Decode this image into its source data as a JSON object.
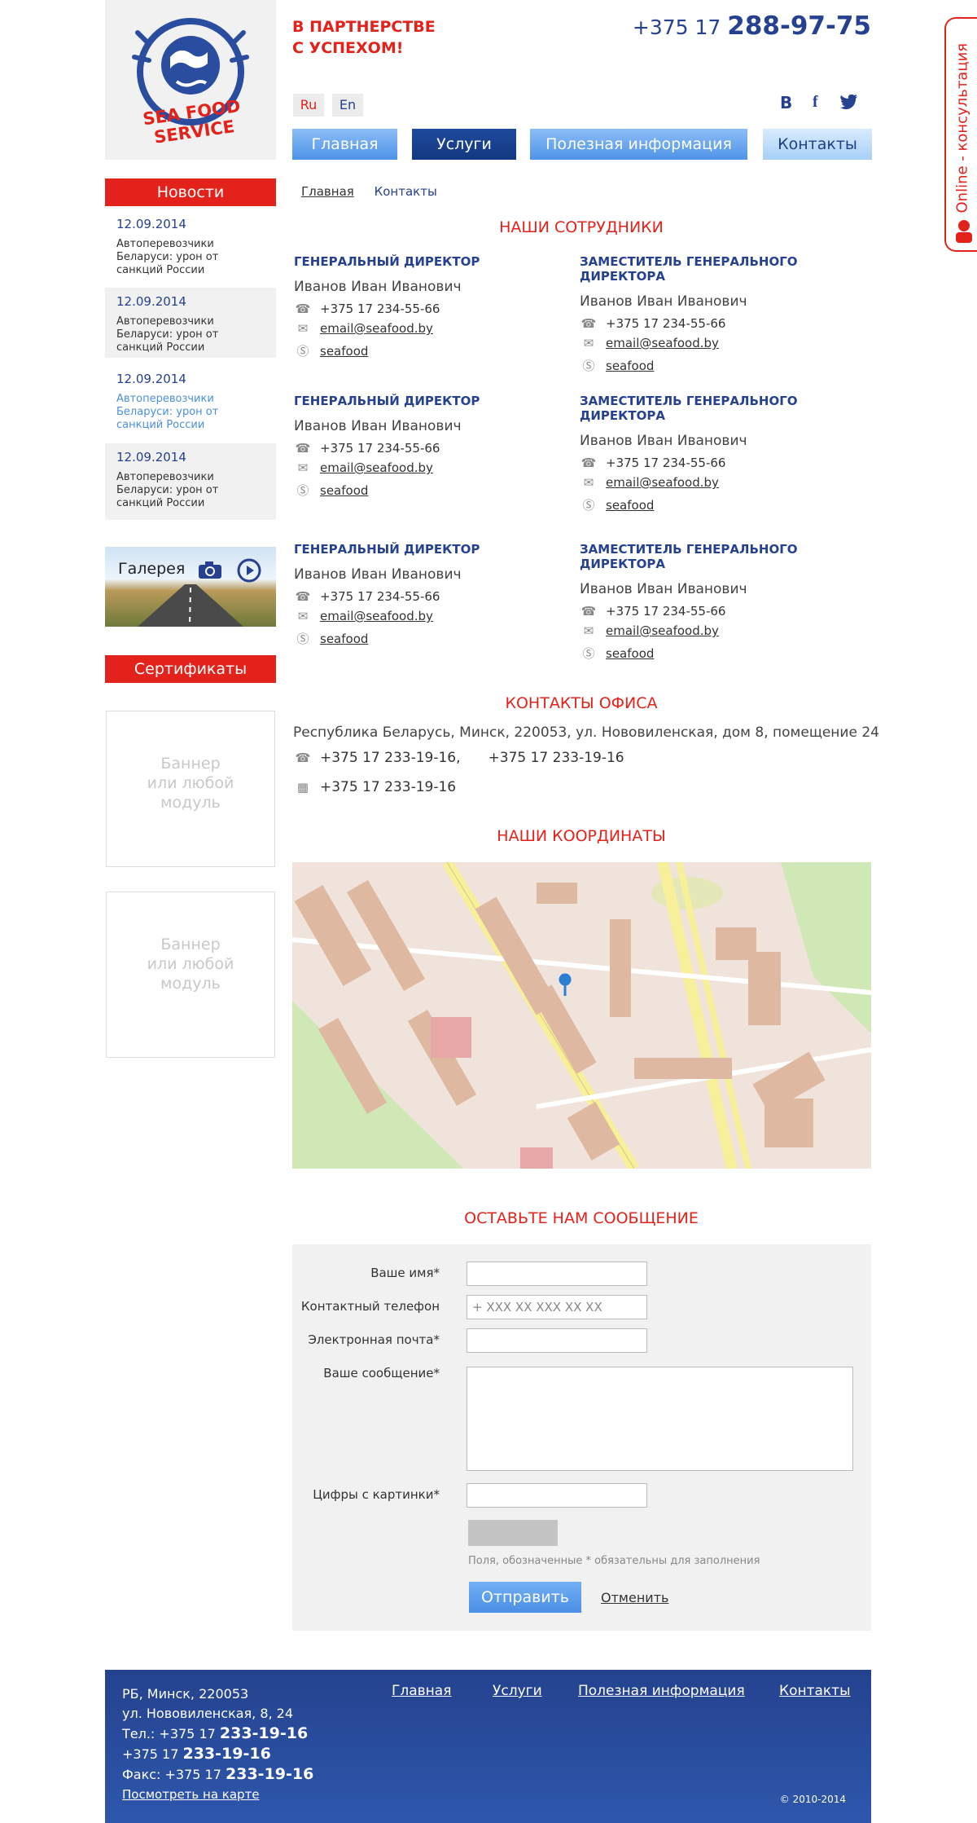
{
  "header": {
    "logo_text": "SEA FOOD SERVICE",
    "slogan_line1": "В ПАРТНЕРСТВЕ",
    "slogan_line2": "С УСПЕХОМ!",
    "phone_prefix": "+375 17",
    "phone_main": "288-97-75",
    "languages": [
      "Ru",
      "En"
    ],
    "social": [
      "В",
      "f",
      "t"
    ]
  },
  "menu": [
    "Главная",
    "Услуги",
    "Полезная информация",
    "Контакты"
  ],
  "side_tab": "Online - консультация",
  "sidebar": {
    "news_title": "Новости",
    "news": [
      {
        "date": "12.09.2014",
        "text": "Автоперевозчики Беларуси: урон от санкций России"
      },
      {
        "date": "12.09.2014",
        "text": "Автоперевозчики Беларуси: урон от санкций России"
      },
      {
        "date": "12.09.2014",
        "text": "Автоперевозчики Беларуси: урон от санкций России"
      },
      {
        "date": "12.09.2014",
        "text": "Автоперевозчики Беларуси: урон от санкций России"
      }
    ],
    "gallery_label": "Галерея",
    "cert_title": "Сертификаты",
    "banner_text": [
      "Баннер",
      "или любой",
      "модуль"
    ]
  },
  "breadcrumb": [
    "Главная",
    "Контакты"
  ],
  "staff": {
    "title": "НАШИ СОТРУДНИКИ",
    "rows": [
      [
        {
          "role": "ГЕНЕРАЛЬНЫЙ ДИРЕКТОР",
          "name": "Иванов Иван Иванович",
          "phone": "+375 17 234-55-66",
          "email": "email@seafood.by",
          "skype": "seafood"
        },
        {
          "role": "ЗАМЕСТИТЕЛЬ ГЕНЕРАЛЬНОГО ДИРЕКТОРА",
          "name": "Иванов Иван Иванович",
          "phone": "+375 17 234-55-66",
          "email": "email@seafood.by",
          "skype": "seafood"
        }
      ],
      [
        {
          "role": "ГЕНЕРАЛЬНЫЙ ДИРЕКТОР",
          "name": "Иванов Иван Иванович",
          "phone": "+375 17 234-55-66",
          "email": "email@seafood.by",
          "skype": "seafood"
        },
        {
          "role": "ЗАМЕСТИТЕЛЬ ГЕНЕРАЛЬНОГО ДИРЕКТОРА",
          "name": "Иванов Иван Иванович",
          "phone": "+375 17 234-55-66",
          "email": "email@seafood.by",
          "skype": "seafood"
        }
      ],
      [
        {
          "role": "ГЕНЕРАЛЬНЫЙ ДИРЕКТОР",
          "name": "Иванов Иван Иванович",
          "phone": "+375 17 234-55-66",
          "email": "email@seafood.by",
          "skype": "seafood"
        },
        {
          "role": "ЗАМЕСТИТЕЛЬ ГЕНЕРАЛЬНОГО ДИРЕКТОРА",
          "name": "Иванов Иван Иванович",
          "phone": "+375 17 234-55-66",
          "email": "email@seafood.by",
          "skype": "seafood"
        }
      ]
    ]
  },
  "office": {
    "title": "КОНТАКТЫ ОФИСА",
    "address": "Республика Беларусь, Минск, 220053, ул. Нововиленская, дом 8, помещение 24",
    "phone1": "+375 17 233-19-16,",
    "phone2": "+375 17 233-19-16",
    "fax": "+375 17 233-19-16"
  },
  "coords_title": "НАШИ КООРДИНАТЫ",
  "form": {
    "title": "ОСТАВЬТЕ НАМ СООБЩЕНИЕ",
    "name_label": "Ваше имя*",
    "phone_label": "Контактный телефон",
    "phone_placeholder": "+ XXX XX XXX XX XX",
    "email_label": "Электронная почта*",
    "message_label": "Ваше сообщение*",
    "captcha_label": "Цифры с картинки*",
    "note": "Поля, обозначенные * обязательны для заполнения",
    "submit": "Отправить",
    "cancel": "Отменить"
  },
  "footer": {
    "addr1": "РБ, Минск, 220053",
    "addr2": "ул. Нововиленская, 8, 24",
    "tel_prefix": "Тел.: +375 17",
    "tel_num": "233-19-16",
    "tel2_prefix": "+375 17",
    "tel2_num": "233-19-16",
    "fax_prefix": "Факс: +375 17",
    "fax_num": "233-19-16",
    "map_link": "Посмотреть на карте",
    "links": [
      "Главная",
      "Услуги",
      "Полезная информация",
      "Контакты"
    ],
    "copyright": "© 2010-2014"
  },
  "colors": {
    "accent_red": "#e3221b",
    "brand_blue": "#25418f"
  }
}
